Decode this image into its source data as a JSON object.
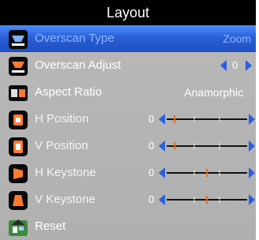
{
  "title": "Layout",
  "items": [
    {
      "label": "Overscan Type",
      "value": "Zoom",
      "icon": "overscan-type-icon"
    },
    {
      "label": "Overscan Adjust",
      "value": "0",
      "icon": "overscan-adjust-icon"
    },
    {
      "label": "Aspect Ratio",
      "value": "Anamorphic",
      "icon": "aspect-ratio-icon"
    },
    {
      "label": "H Position",
      "value": "0",
      "level": 0.1,
      "icon": "h-position-icon"
    },
    {
      "label": "V Position",
      "value": "0",
      "level": 0.1,
      "icon": "v-position-icon"
    },
    {
      "label": "H Keystone",
      "value": "0",
      "level": 0.5,
      "icon": "h-keystone-icon"
    },
    {
      "label": "V Keystone",
      "value": "0",
      "level": 0.5,
      "icon": "v-keystone-icon"
    },
    {
      "label": "Reset",
      "icon": "reset-icon"
    }
  ],
  "colors": {
    "selected_row": "#2960d6",
    "selected_text": "#8fb4ff",
    "arrow": "#2a5fe0",
    "marker": "#e07020",
    "menu_bg": "#b4b4b4"
  }
}
